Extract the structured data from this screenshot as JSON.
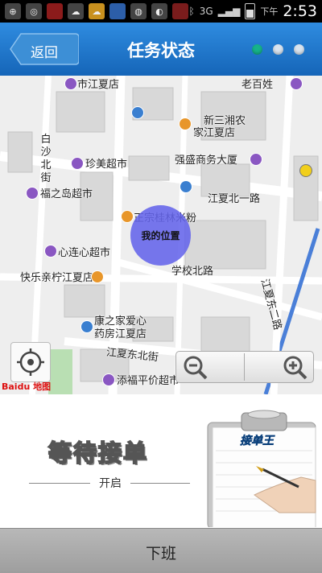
{
  "status_bar": {
    "time": "2:53",
    "ampm": "下午",
    "network": "3G"
  },
  "header": {
    "back_label": "返回",
    "title": "任务状态",
    "page_dots": [
      true,
      false,
      false
    ]
  },
  "map": {
    "labels": {
      "jiangxia_store": "市江夏店",
      "laobaixing": "老百姓",
      "xinsanxiang": "新三湘农",
      "jiangxia_shop": "家江夏店",
      "baiyun": "白",
      "shashe": "沙",
      "beijie": "北",
      "jie": "街",
      "zhenmei": "珍美超市",
      "qiangsheng": "强盛商务大厦",
      "fuzhidao": "福之岛超市",
      "jiangxia_bei1": "江夏北一路",
      "zhengzong": "正宗桂林米粉",
      "xinlianxin": "心连心超市",
      "my_position": "我的位置",
      "xuexiao_bei": "学校北路",
      "kuaile": "快乐亲柠江夏店",
      "jiangxia_dong": "江夏东二路",
      "kangzhijia": "康之家爱心",
      "yaofang": "药房江夏店",
      "jiangxia_dongbei": "江夏东北街",
      "tianfu": "添福平价超市",
      "baidu": "Baidu 地图"
    }
  },
  "panel": {
    "wait_text": "等待接单",
    "open_text": "开启",
    "clipboard_brand": "接单王"
  },
  "cta": {
    "off_duty_label": "下班"
  }
}
